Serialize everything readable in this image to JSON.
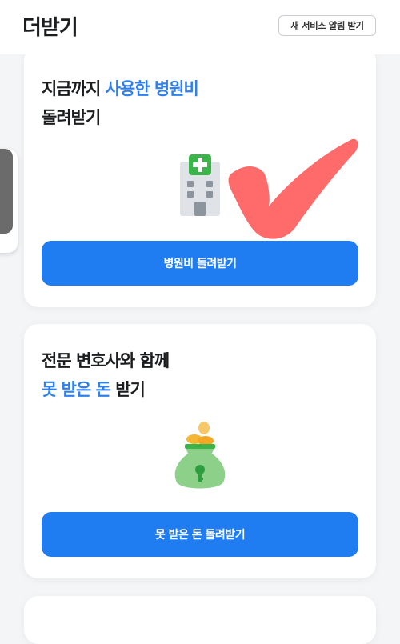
{
  "header": {
    "title": "더받기",
    "notify_label": "새 서비스 알림 받기"
  },
  "cards": [
    {
      "title_line1_plain": "지금까지 ",
      "title_line1_accent": "사용한 병원비",
      "title_line2_plain": "돌려받기",
      "icon": "hospital-icon",
      "button_label": "병원비 돌려받기"
    },
    {
      "title_line1_plain": "전문 변호사와 함께",
      "title_line2_accent": "못 받은 돈",
      "title_line2_plain": " 받기",
      "icon": "money-bag-icon",
      "button_label": "못 받은 돈 돌려받기"
    }
  ],
  "colors": {
    "accent": "#2f80ed",
    "button": "#1f7df1",
    "hospital_cross": "#3bb54a",
    "money_bag": "#8dd08a",
    "coin": "#f5b731",
    "checkmark": "#ff5a5a"
  }
}
